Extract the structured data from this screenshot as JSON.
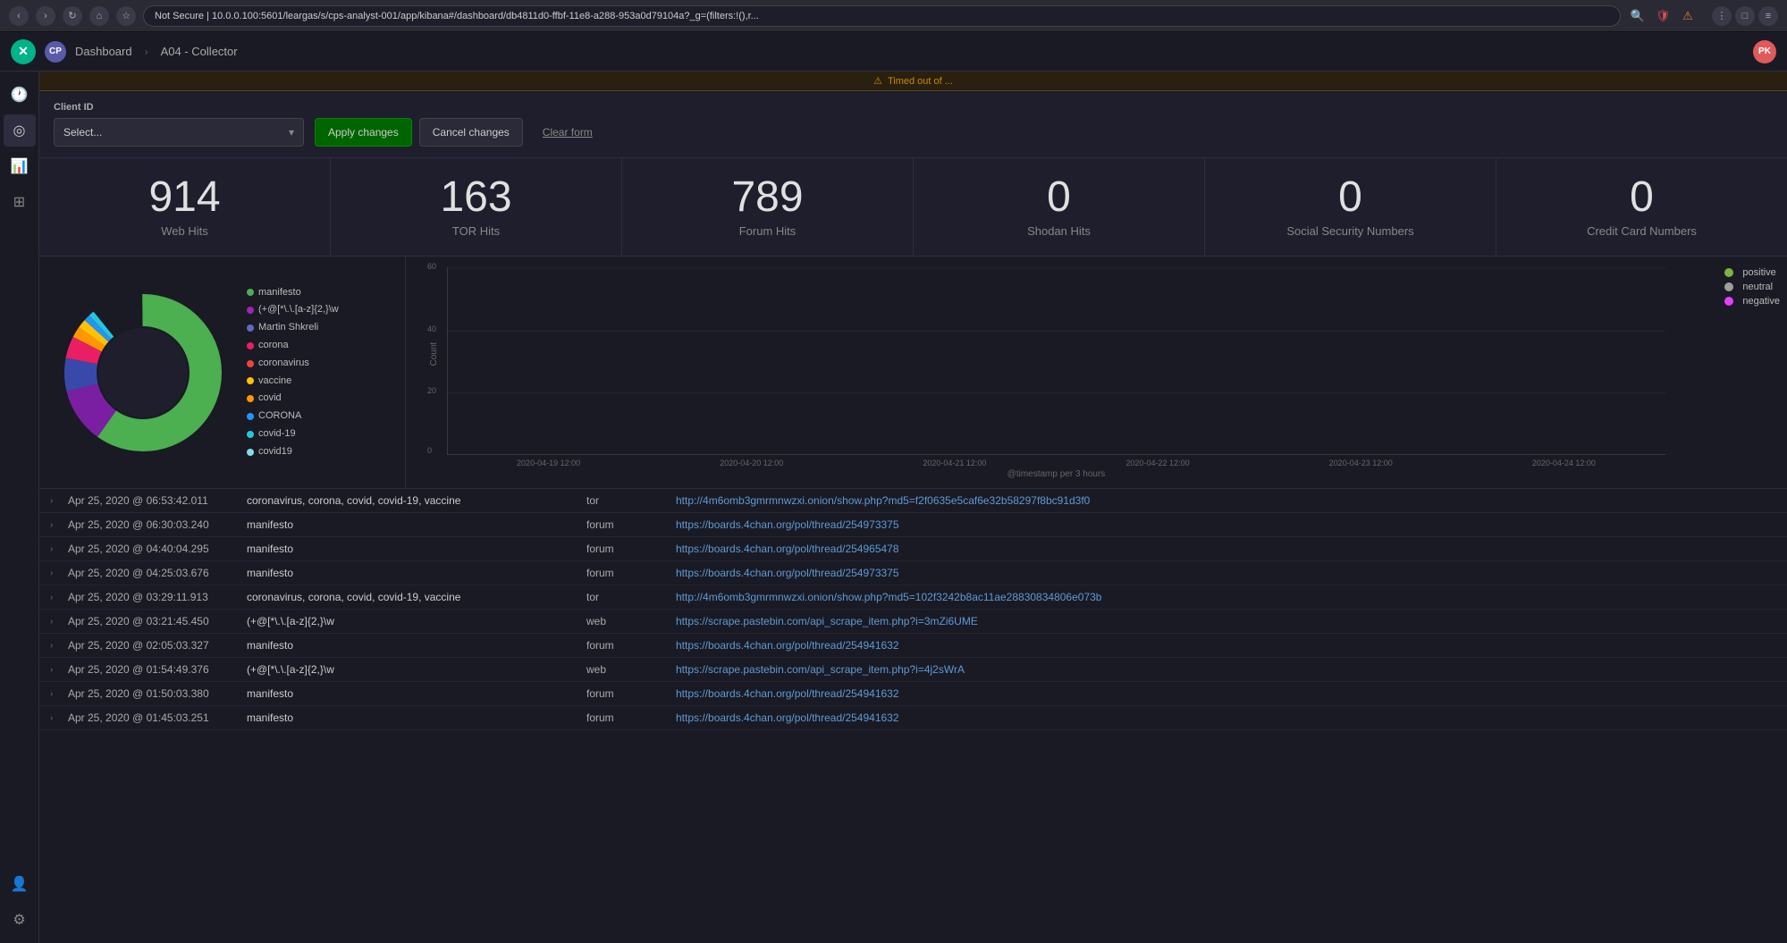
{
  "browser": {
    "url": "Not Secure | 10.0.0.100:5601/leargas/s/cps-analyst-001/app/kibana#/dashboard/db4811d0-ffbf-11e8-a288-953a0d79104a?_g=(filters:!(),r...",
    "security_label": "Not Secure"
  },
  "app": {
    "logo": "✕",
    "client_badge": "CP",
    "breadcrumb": [
      "Dashboard",
      "A04 - Collector"
    ],
    "user_initials": "PK"
  },
  "warning": {
    "icon": "⚠",
    "message": "Timed out of ..."
  },
  "filter": {
    "client_id_label": "Client ID",
    "select_placeholder": "Select...",
    "apply_label": "Apply changes",
    "cancel_label": "Cancel changes",
    "clear_label": "Clear form"
  },
  "stats": [
    {
      "number": "914",
      "label": "Web Hits"
    },
    {
      "number": "163",
      "label": "TOR Hits"
    },
    {
      "number": "789",
      "label": "Forum Hits"
    },
    {
      "number": "0",
      "label": "Shodan Hits"
    },
    {
      "number": "0",
      "label": "Social Security Numbers"
    },
    {
      "number": "0",
      "label": "Credit Card Numbers"
    }
  ],
  "donut_legend": [
    {
      "color": "#4CAF50",
      "label": "manifesto"
    },
    {
      "color": "#9C27B0",
      "label": "(+@[*\\.\\.[a-z]{2,}\\w"
    },
    {
      "color": "#5c6bc0",
      "label": "Martin Shkreli"
    },
    {
      "color": "#e91e63",
      "label": "corona"
    },
    {
      "color": "#f44336",
      "label": "coronavirus"
    },
    {
      "color": "#FFC107",
      "label": "vaccine"
    },
    {
      "color": "#FF9800",
      "label": "covid"
    },
    {
      "color": "#2196F3",
      "label": "CORONA"
    },
    {
      "color": "#26C6DA",
      "label": "covid-19"
    },
    {
      "color": "#80DEEA",
      "label": "covid19"
    }
  ],
  "bar_chart": {
    "y_labels": [
      "0",
      "20",
      "40",
      "60"
    ],
    "x_labels": [
      "2020-04-19 12:00",
      "2020-04-20 12:00",
      "2020-04-21 12:00",
      "2020-04-22 12:00",
      "2020-04-23 12:00",
      "2020-04-24 12:00"
    ],
    "x_axis_title": "@timestamp per 3 hours",
    "legend": [
      {
        "color": "#7CB342",
        "label": "positive"
      },
      {
        "color": "#9E9E9E",
        "label": "neutral"
      },
      {
        "color": "#E040FB",
        "label": "negative"
      }
    ]
  },
  "table_rows": [
    {
      "timestamp": "Apr 25, 2020 @ 06:53:42.011",
      "keywords": "coronavirus, corona, covid, covid-19, vaccine",
      "source": "tor",
      "url": "http://4m6omb3gmrmnwzxi.onion/show.php?md5=f2f0635e5caf6e32b58297f8bc91d3f0"
    },
    {
      "timestamp": "Apr 25, 2020 @ 06:30:03.240",
      "keywords": "manifesto",
      "source": "forum",
      "url": "https://boards.4chan.org/pol/thread/254973375"
    },
    {
      "timestamp": "Apr 25, 2020 @ 04:40:04.295",
      "keywords": "manifesto",
      "source": "forum",
      "url": "https://boards.4chan.org/pol/thread/254965478"
    },
    {
      "timestamp": "Apr 25, 2020 @ 04:25:03.676",
      "keywords": "manifesto",
      "source": "forum",
      "url": "https://boards.4chan.org/pol/thread/254973375"
    },
    {
      "timestamp": "Apr 25, 2020 @ 03:29:11.913",
      "keywords": "coronavirus, corona, covid, covid-19, vaccine",
      "source": "tor",
      "url": "http://4m6omb3gmrmnwzxi.onion/show.php?md5=102f3242b8ac11ae28830834806e073b"
    },
    {
      "timestamp": "Apr 25, 2020 @ 03:21:45.450",
      "keywords": "(+@[*\\.\\.[a-z]{2,}\\w",
      "source": "web",
      "url": "https://scrape.pastebin.com/api_scrape_item.php?i=3mZi6UME"
    },
    {
      "timestamp": "Apr 25, 2020 @ 02:05:03.327",
      "keywords": "manifesto",
      "source": "forum",
      "url": "https://boards.4chan.org/pol/thread/254941632"
    },
    {
      "timestamp": "Apr 25, 2020 @ 01:54:49.376",
      "keywords": "(+@[*\\.\\.[a-z]{2,}\\w",
      "source": "web",
      "url": "https://scrape.pastebin.com/api_scrape_item.php?i=4j2sWrA"
    },
    {
      "timestamp": "Apr 25, 2020 @ 01:50:03.380",
      "keywords": "manifesto",
      "source": "forum",
      "url": "https://boards.4chan.org/pol/thread/254941632"
    },
    {
      "timestamp": "Apr 25, 2020 @ 01:45:03.251",
      "keywords": "manifesto",
      "source": "forum",
      "url": "https://boards.4chan.org/pol/thread/254941632"
    }
  ],
  "sidebar": {
    "items": [
      {
        "icon": "🕐",
        "name": "history"
      },
      {
        "icon": "◎",
        "name": "home"
      },
      {
        "icon": "📊",
        "name": "visualize"
      },
      {
        "icon": "🗂",
        "name": "dashboard"
      },
      {
        "icon": "👤",
        "name": "user"
      },
      {
        "icon": "⚙",
        "name": "settings"
      }
    ]
  }
}
